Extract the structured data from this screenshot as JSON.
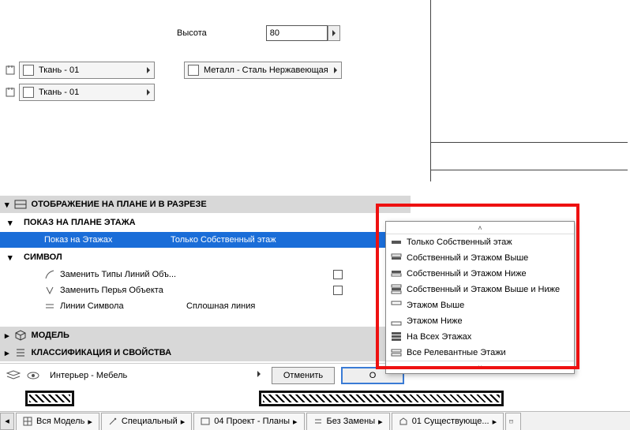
{
  "height": {
    "label": "Высота",
    "value": "80"
  },
  "materials": {
    "fabric": "Ткань - 01",
    "metal": "Металл - Сталь Нержавеющая"
  },
  "sections": {
    "display": "ОТОБРАЖЕНИЕ НА ПЛАНЕ И В РАЗРЕЗЕ",
    "floorplan": "ПОКАЗ НА ПЛАНЕ ЭТАЖА",
    "symbol": "СИМВОЛ",
    "model": "МОДЕЛЬ",
    "class": "КЛАССИФИКАЦИЯ И СВОЙСТВА"
  },
  "rows": {
    "showOn": {
      "label": "Показ на Этажах",
      "value": "Только Собственный этаж"
    },
    "lineTypes": {
      "label": "Заменить Типы Линий Объ..."
    },
    "pens": {
      "label": "Заменить Перья Объекта"
    },
    "symLines": {
      "label": "Линии Символа",
      "value": "Сплошная линия"
    }
  },
  "popup": {
    "items": [
      "Только Собственный этаж",
      "Собственный и Этажом Выше",
      "Собственный и Этажом Ниже",
      "Собственный и Этажом Выше и Ниже",
      "Этажом Выше",
      "Этажом Ниже",
      "На Всех Этажах",
      "Все Релевантные Этажи"
    ]
  },
  "footer": {
    "layer": "Интерьер - Мебель",
    "cancel": "Отменить",
    "ok": "О"
  },
  "tabs": {
    "t1": "Вся Модель",
    "t2": "Специальный",
    "t3": "04 Проект - Планы",
    "t4": "Без Замены",
    "t5": "01 Существующе..."
  }
}
